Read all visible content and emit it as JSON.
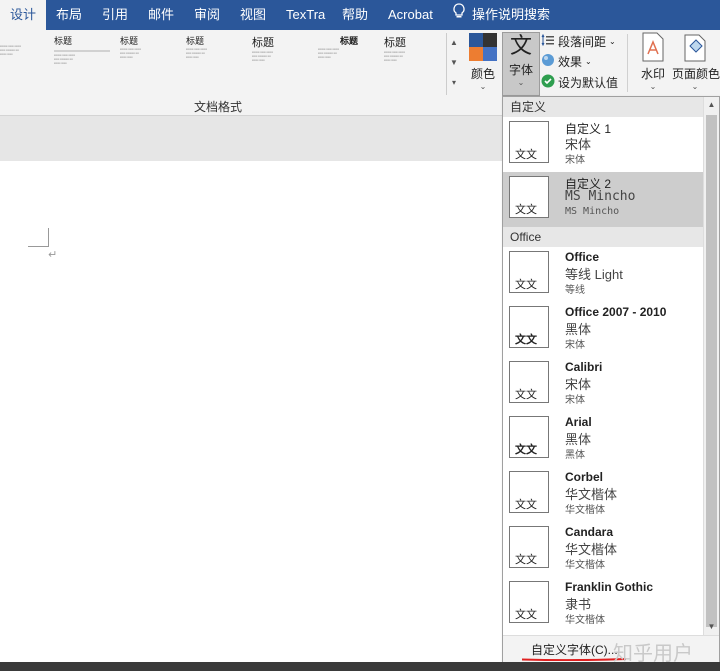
{
  "tabs": [
    "设计",
    "布局",
    "引用",
    "邮件",
    "审阅",
    "视图",
    "TexTra",
    "帮助",
    "Acrobat"
  ],
  "tell_me": "操作说明搜索",
  "gallery": [
    {
      "title": "标题"
    },
    {
      "title": "标题"
    },
    {
      "title": "标题"
    },
    {
      "title": "标题"
    },
    {
      "title": "标题"
    },
    {
      "title": "标题"
    },
    {
      "title": "标题"
    }
  ],
  "ribbon": {
    "colors": "颜色",
    "fonts": "字体",
    "fonts_glyph": "文",
    "para_spacing": "段落间距",
    "effects": "效果",
    "set_default": "设为默认值",
    "watermark": "水印",
    "page_color": "页面颜色",
    "group_label": "文档格式"
  },
  "dropdown": {
    "section_custom": "自定义",
    "section_office": "Office",
    "custom_items": [
      {
        "name": "自定义 1",
        "heading": "宋体",
        "body": "宋体",
        "selected": false
      },
      {
        "name": "自定义 2",
        "heading": "MS Mincho",
        "body": "MS Mincho",
        "selected": true
      }
    ],
    "office_items": [
      {
        "name": "Office",
        "heading": "等线 Light",
        "body": "等线"
      },
      {
        "name": "Office 2007 - 2010",
        "heading": "黑体",
        "body": "宋体"
      },
      {
        "name": "Calibri",
        "heading": "宋体",
        "body": "宋体"
      },
      {
        "name": "Arial",
        "heading": "黑体",
        "body": "黑体"
      },
      {
        "name": "Corbel",
        "heading": "华文楷体",
        "body": "华文楷体"
      },
      {
        "name": "Candara",
        "heading": "华文楷体",
        "body": "华文楷体"
      },
      {
        "name": "Franklin Gothic",
        "heading": "隶书",
        "body": "华文楷体"
      }
    ],
    "preview_glyph": "文文",
    "custom_fonts": "自定义字体(C)...",
    "watermark": "知乎用户"
  },
  "paragraph_mark": "↵",
  "colors": {
    "accent": "#2b579a",
    "underline": "#e02020"
  }
}
